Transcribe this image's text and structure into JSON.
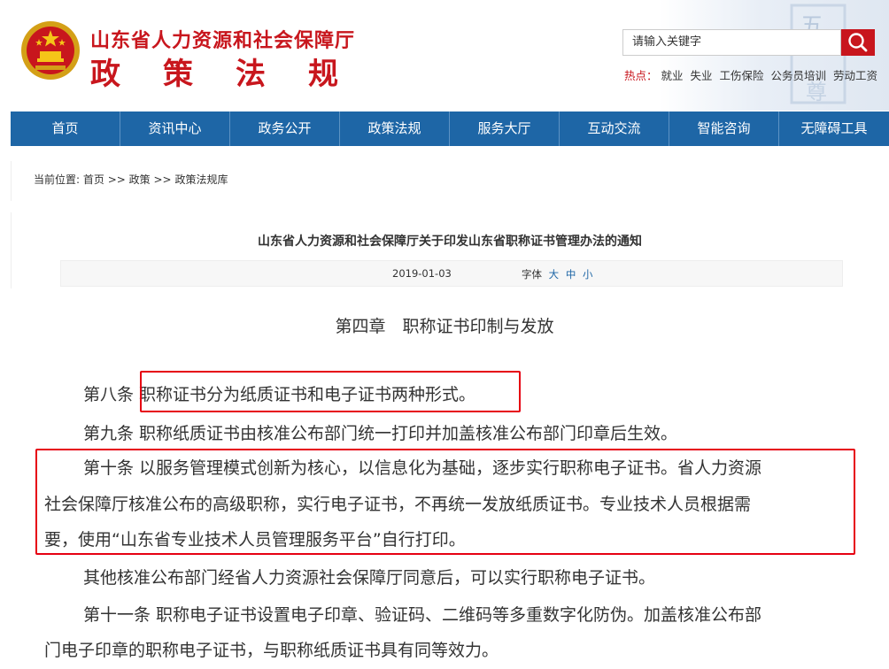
{
  "header": {
    "org_name": "山东省人力资源和社会保障厅",
    "section_chars": [
      "政",
      "策",
      "法",
      "规"
    ],
    "search_placeholder": "请输入关键字",
    "hot_label": "热点：",
    "hot_keywords": [
      "就业",
      "失业",
      "工伤保险",
      "公务员培训",
      "劳动工资"
    ],
    "deco_chars": [
      "五",
      "尊"
    ]
  },
  "nav": {
    "items": [
      "首页",
      "资讯中心",
      "政务公开",
      "政策法规",
      "服务大厅",
      "互动交流",
      "智能咨询",
      "无障碍工具"
    ]
  },
  "breadcrumb": {
    "prefix": "当前位置:",
    "home": "首页",
    "sep1": ">>",
    "level1": "政策",
    "sep2": ">>",
    "level2": "政策法规库"
  },
  "article": {
    "title": "山东省人力资源和社会保障厅关于印发山东省职称证书管理办法的通知",
    "date": "2019-01-03",
    "font_label": "字体",
    "font_sizes": [
      "大",
      "中",
      "小"
    ],
    "chapter": "第四章　职称证书印制与发放",
    "lines": [
      "第八条  职称证书分为纸质证书和电子证书两种形式。",
      "第九条  职称纸质证书由核准公布部门统一打印并加盖核准公布部门印章后生效。",
      "第十条  以服务管理模式创新为核心，以信息化为基础，逐步实行职称电子证书。省人力资源",
      "社会保障厅核准公布的高级职称，实行电子证书，不再统一发放纸质证书。专业技术人员根据需",
      "要，使用“山东省专业技术人员管理服务平台”自行打印。",
      "其他核准公布部门经省人力资源社会保障厅同意后，可以实行职称电子证书。",
      "第十一条  职称电子证书设置电子印章、验证码、二维码等多重数字化防伪。加盖核准公布部",
      "门电子印章的职称电子证书，与职称纸质证书具有同等效力。"
    ]
  },
  "colors": {
    "brand_red": "#c8161d",
    "nav_blue": "#1e66a6",
    "highlight_red": "#e60012"
  }
}
